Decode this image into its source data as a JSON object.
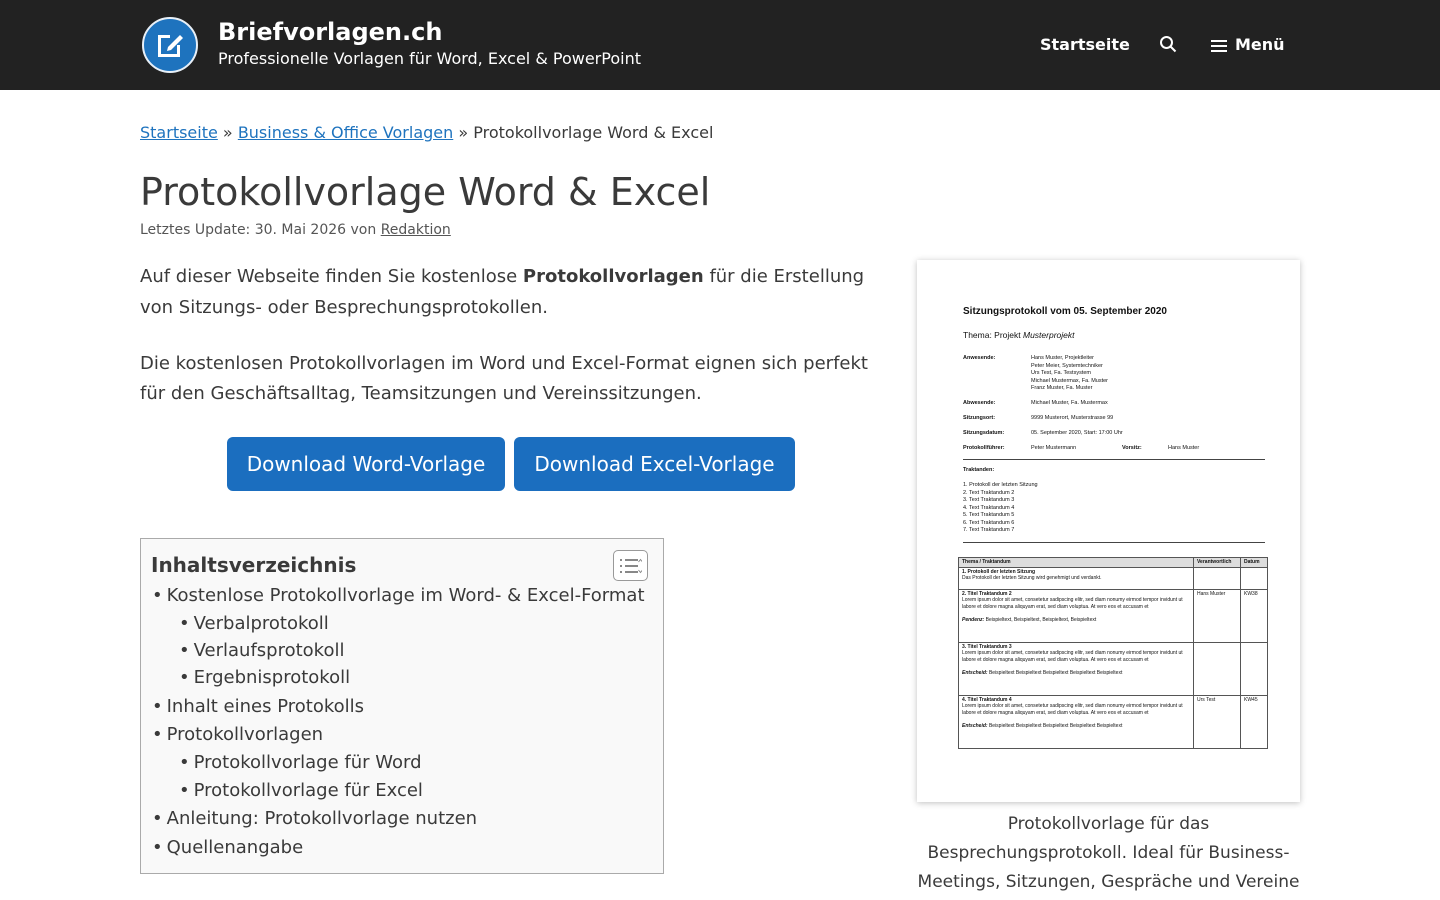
{
  "header": {
    "site_title": "Briefvorlagen.ch",
    "tagline": "Professionelle Vorlagen für Word, Excel & PowerPoint",
    "nav_home": "Startseite",
    "nav_menu": "Menü",
    "brand_color": "#1e73be",
    "bg_color": "#222222"
  },
  "breadcrumb": {
    "home": "Startseite",
    "sep": "»",
    "category": "Business & Office Vorlagen",
    "current": "Protokollvorlage Word & Excel"
  },
  "article": {
    "title": "Protokollvorlage Word & Excel",
    "meta_prefix": "Letztes Update: 30. Mai 2026 von",
    "author": "Redaktion",
    "p1_before": "Auf dieser Webseite finden Sie kostenlose ",
    "p1_bold": "Protokollvorlagen",
    "p1_after": " für die Erstellung von Sitzungs- oder Besprechungsprotokollen.",
    "p2": "Die kostenlosen Protokollvorlagen im Word und Excel-Format eignen sich perfekt für den Geschäftsalltag, Teamsitzungen und Vereinssitzungen.",
    "btn_word": "Download Word-Vorlage",
    "btn_excel": "Download Excel-Vorlage"
  },
  "toc": {
    "title": "Inhaltsverzeichnis",
    "items": [
      {
        "label": "Kostenlose Protokollvorlage im Word- & Excel-Format",
        "level": 1
      },
      {
        "label": "Verbalprotokoll",
        "level": 2
      },
      {
        "label": "Verlaufsprotokoll",
        "level": 2
      },
      {
        "label": "Ergebnisprotokoll",
        "level": 2
      },
      {
        "label": "Inhalt eines Protokolls",
        "level": 1
      },
      {
        "label": "Protokollvorlagen",
        "level": 1
      },
      {
        "label": "Protokollvorlage für Word",
        "level": 2
      },
      {
        "label": "Protokollvorlage für Excel",
        "level": 2
      },
      {
        "label": "Anleitung: Protokollvorlage nutzen",
        "level": 1
      },
      {
        "label": "Quellenangabe",
        "level": 1
      }
    ]
  },
  "figure": {
    "caption": "Protokollvorlage für das Besprechungsprotokoll. Ideal für Business-Meetings, Sitzungen, Gespräche und Vereine",
    "doc": {
      "title": "Sitzungsprotokoll vom 05. September 2020",
      "topic_label": "Thema: Projekt ",
      "topic_value": "Musterprojekt",
      "anwesende_label": "Anwesende:",
      "anwesende": [
        "Hans Muster, Projektleiter",
        "Peter Meier, Systemtechniker",
        "Urs Test, Fa. Testsystem",
        "Michael Mustermax, Fa. Muster",
        "Franz Muster, Fa. Muster"
      ],
      "abwesende_label": "Abwesende:",
      "abwesende": "Michael Muster, Fa. Mustermax",
      "ort_label": "Sitzungsort:",
      "ort": "9999 Musterort, Musterstrasse 99",
      "datum_label": "Sitzungsdatum:",
      "datum": "05. September 2020, Start: 17:00 Uhr",
      "fuehrer_label": "Protokollführer:",
      "fuehrer": "Peter Mustermann",
      "vorsitz_label": "Vorsitz:",
      "vorsitz": "Hans Muster",
      "traktanden_label": "Traktanden:",
      "traktanden": [
        "1.   Protokoll der letzten Sitzung",
        "2.   Text Traktandum 2",
        "3.   Text Traktandum 3",
        "4.   Text Traktandum 4",
        "5.   Text Traktandum 5",
        "6.   Text Traktandum 6",
        "7.   Text Traktandum 7"
      ],
      "table_head": [
        "Thema / Traktandum",
        "Verantwortlich",
        "Datum"
      ],
      "r1_title": "1. Protokoll der letzten Sitzung",
      "r1_text": "Das Protokoll der letzten Sitzung wird genehmigt und verdankt.",
      "r2_title": "2. Titel Traktandum 2",
      "r2_text": "Lorem ipsum dolor sit amet, consetetur sadipscing elitr, sed diam nonumy eirmod tempor invidunt ut labore et dolore magna aliquyam erat, sed diam voluptua. At vero eos et accusam et",
      "r2_note_label": "Pendenz:",
      "r2_note": " Beispieltext, Beispieltext, Beispieltext, Beispieltext",
      "r2_resp": "Hans Muster",
      "r2_date": "KW38",
      "r3_title": "3. Titel Traktandum 3",
      "r3_text": "Lorem ipsum dolor sit amet, consetetur sadipscing elitr, sed diam nonumy eirmod tempor invidunt ut labore et dolore magna aliquyam erat, sed diam voluptua. At vero eos et accusam et",
      "r3_note_label": "Entscheid:",
      "r3_note": " Beispieltext Beispieltext Beispieltext Beispieltext Beispieltext",
      "r4_title": "4. Titel Traktandum 4",
      "r4_text": "Lorem ipsum dolor sit amet, consetetur sadipscing elitr, sed diam nonumy eirmod tempor invidunt ut labore et dolore magna aliquyam erat, sed diam voluptua. At vero eos et accusam et",
      "r4_note_label": "Entscheid:",
      "r4_note": " Beispieltext Beispieltext Beispieltext Beispieltext Beispieltext",
      "r4_resp": "Urs Test",
      "r4_date": "KW45"
    }
  }
}
